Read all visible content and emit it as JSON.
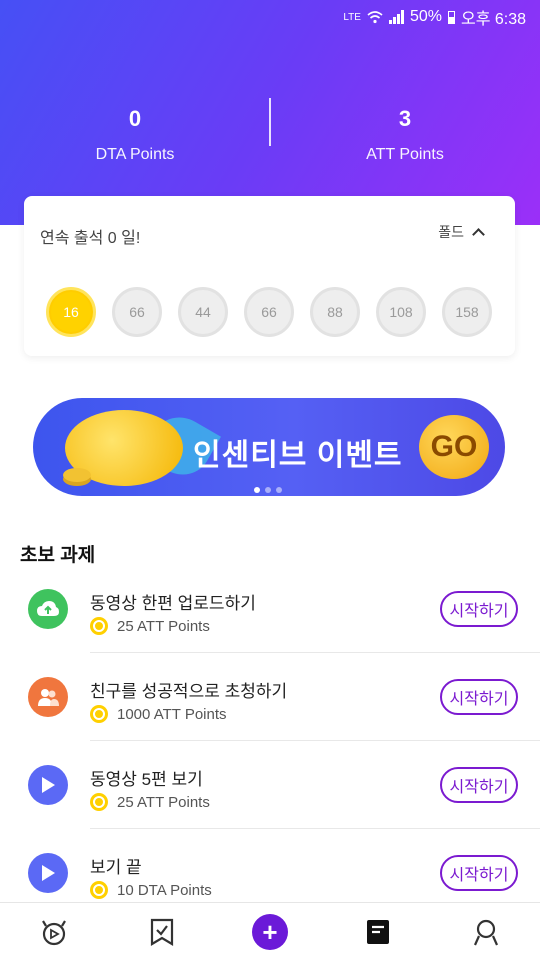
{
  "status": {
    "net": "LTE",
    "battery": "50%",
    "time": "오후 6:38"
  },
  "points": [
    {
      "value": "0",
      "label": "DTA Points"
    },
    {
      "value": "3",
      "label": "ATT Points"
    }
  ],
  "attendance": {
    "title": "연속 출석 0 일!",
    "fold_label": "폴드",
    "days": [
      "16",
      "66",
      "44",
      "66",
      "88",
      "108",
      "158"
    ],
    "active_index": 0
  },
  "banner": {
    "text": "인센티브 이벤트",
    "go_label": "GO",
    "page_count": 3,
    "active_page": 1
  },
  "section_title": "초보 과제",
  "tasks": [
    {
      "name": "동영상 한편 업로드하기",
      "reward": "25 ATT Points",
      "button": "시작하기",
      "icon": "cloud-upload-icon",
      "color": "green"
    },
    {
      "name": "친구를 성공적으로 초청하기",
      "reward": "1000 ATT Points",
      "button": "시작하기",
      "icon": "friends-icon",
      "color": "orange"
    },
    {
      "name": "동영상 5편 보기",
      "reward": "25 ATT Points",
      "button": "시작하기",
      "icon": "play-icon",
      "color": "blue"
    },
    {
      "name": "보기 끝",
      "reward": "10 DTA Points",
      "button": "시작하기",
      "icon": "play-icon",
      "color": "blue"
    }
  ],
  "nav": [
    "home-icon",
    "checklist-icon",
    "plus-icon",
    "tasks-icon",
    "profile-icon"
  ],
  "colors": {
    "accent": "#7b1ad0",
    "header_start": "#4650f5",
    "header_end": "#9b2ff8",
    "coin": "#ffd000"
  }
}
